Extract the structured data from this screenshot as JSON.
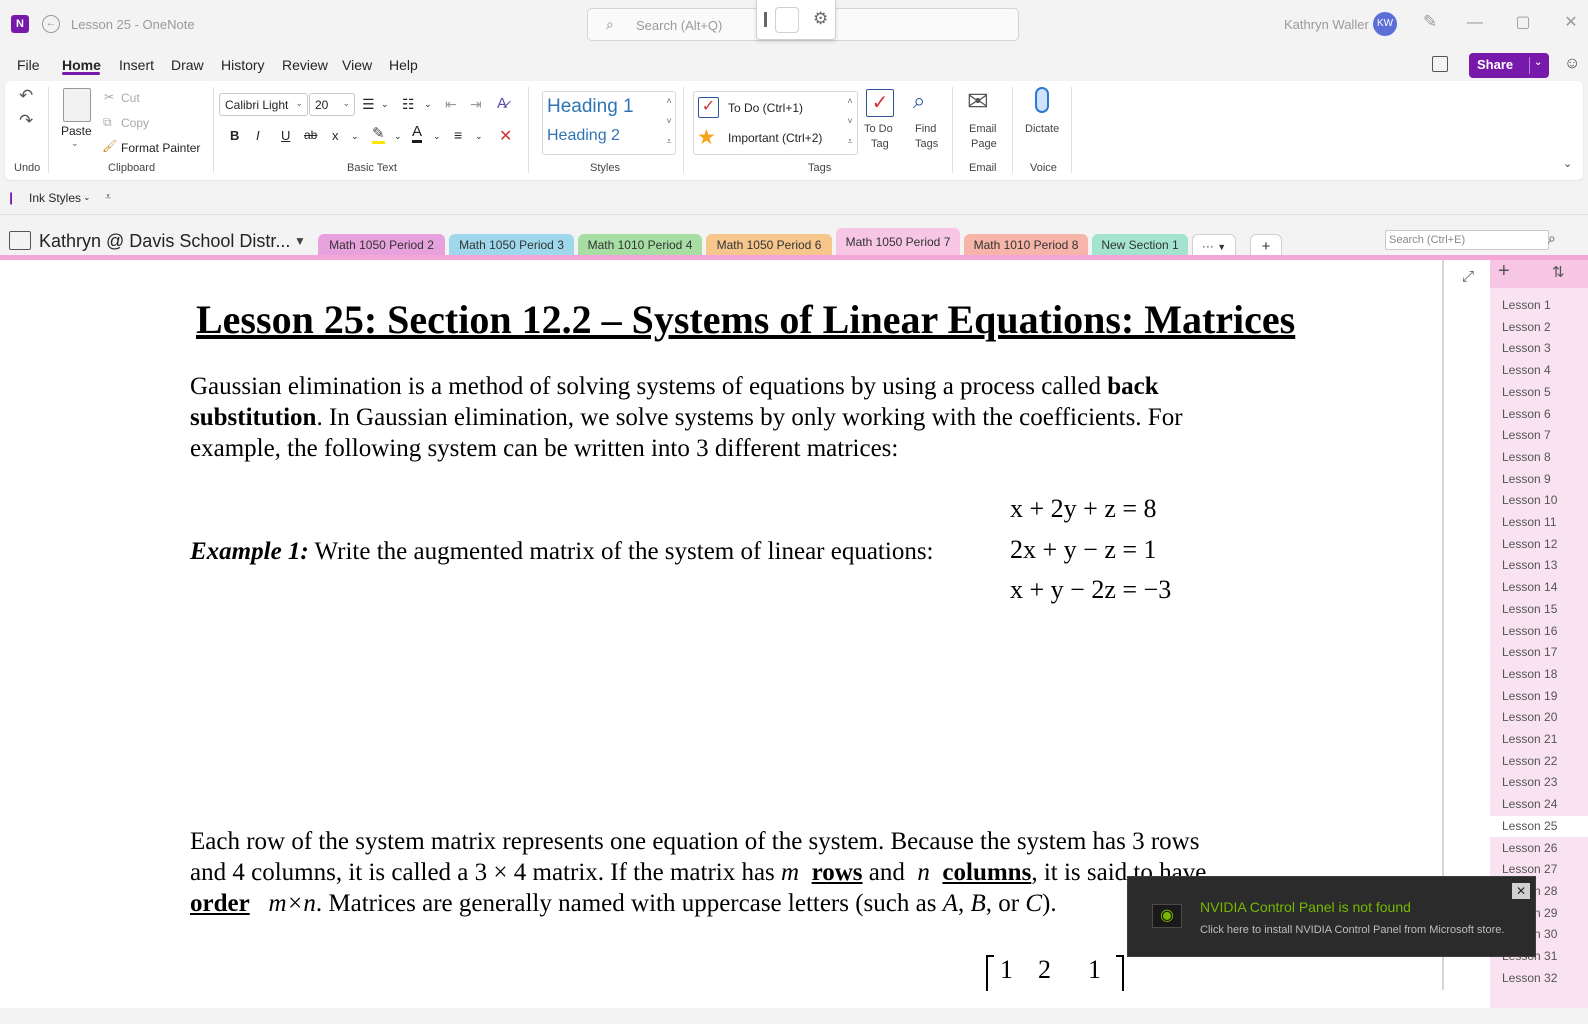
{
  "titlebar": {
    "doc_title": "Lesson 25  -  OneNote",
    "logo_text": "N",
    "search_placeholder": "Search (Alt+Q)",
    "user_name": "Kathryn Waller",
    "user_initials": "KW",
    "minimize": "—",
    "maximize": "▢",
    "close": "✕"
  },
  "menu": {
    "items": [
      "File",
      "Home",
      "Insert",
      "Draw",
      "History",
      "Review",
      "View",
      "Help"
    ],
    "active": "Home",
    "share_label": "Share"
  },
  "ribbon": {
    "undo_group": "Undo",
    "clipboard": {
      "paste": "Paste",
      "cut": "Cut",
      "copy": "Copy",
      "format_painter": "Format Painter",
      "label": "Clipboard"
    },
    "basic_text": {
      "font": "Calibri Light",
      "size": "20",
      "label": "Basic Text",
      "bold": "B",
      "italic": "I",
      "underline": "U",
      "strike": "ab",
      "subscript": "x",
      "font_color_letter": "A"
    },
    "styles": {
      "heading1": "Heading 1",
      "heading2": "Heading 2",
      "label": "Styles"
    },
    "tags": {
      "todo": "To Do (Ctrl+1)",
      "important": "Important (Ctrl+2)",
      "todo_tag_line1": "To Do",
      "todo_tag_line2": "Tag",
      "find_tags_line1": "Find",
      "find_tags_line2": "Tags",
      "label": "Tags"
    },
    "email": {
      "line1": "Email",
      "line2": "Page",
      "label": "Email"
    },
    "voice": {
      "dictate": "Dictate",
      "label": "Voice"
    }
  },
  "quick_access": {
    "ink_styles": "Ink Styles"
  },
  "notebook": {
    "name": "Kathryn @ Davis School Distr...",
    "sections": [
      {
        "label": "Math 1050 Period 2",
        "color": "#e7a1dc"
      },
      {
        "label": "Math 1050 Period 3",
        "color": "#9fd8ec"
      },
      {
        "label": "Math 1010 Period 4",
        "color": "#a6dea4"
      },
      {
        "label": "Math 1050 Period 6",
        "color": "#f6c68d"
      },
      {
        "label": "Math 1050 Period 7",
        "color": "#f6c6e4"
      },
      {
        "label": "Math 1010 Period 8",
        "color": "#f7b4a8"
      },
      {
        "label": "New Section 1",
        "color": "#a3e3cf"
      }
    ],
    "active_section": "Math 1050 Period 7",
    "more_sections": "···",
    "add_section": "+",
    "page_search_placeholder": "Search (Ctrl+E)"
  },
  "page": {
    "title": "Lesson 25: Section 12.2 – Systems of Linear Equations:  Matrices",
    "p1": {
      "line1_a": "Gaussian elimination is a method of solving systems of equations by using a process called ",
      "line1_b": "back",
      "line2_a": "substitution",
      "line2_b": ".  In Gaussian elimination, we solve systems by only working with the coefficients.  For",
      "line3": "example, the following system can be written into 3 different matrices:"
    },
    "example": {
      "label": "Example 1:",
      "text": "  Write the augmented matrix of the system of linear equations:"
    },
    "equations": [
      "x + 2y + z = 8",
      "2x + y − z = 1",
      "x + y − 2z = −3"
    ],
    "p2": {
      "line1": "Each row of the system matrix represents one equation of the system.  Because the system has 3 rows",
      "line2_a": "and 4 columns, it is called a 3 × 4 matrix.   If the matrix has ",
      "line2_m": "m",
      "line2_rows": "rows",
      "line2_and": " and ",
      "line2_n": "n",
      "line2_cols": "columns",
      "line2_end": ", it is said to have",
      "line3_order": "order",
      "line3_mn": "m×n",
      "line3_rest_a": ".  Matrices are generally named with uppercase letters (such as ",
      "line3_A": "A",
      "line3_B": "B",
      "line3_or": ", or ",
      "line3_C": "C",
      "line3_end": ")."
    },
    "matrix_row1": [
      "1",
      "2",
      "1"
    ]
  },
  "pages": [
    "Lesson 1",
    "Lesson 2",
    "Lesson 3",
    "Lesson 4",
    "Lesson 5",
    "Lesson 6",
    "Lesson 7",
    "Lesson 8",
    "Lesson 9",
    "Lesson 10",
    "Lesson 11",
    "Lesson 12",
    "Lesson 13",
    "Lesson 14",
    "Lesson 15",
    "Lesson 16",
    "Lesson 17",
    "Lesson 18",
    "Lesson 19",
    "Lesson 20",
    "Lesson 21",
    "Lesson 22",
    "Lesson 23",
    "Lesson 24",
    "Lesson 25",
    "Lesson 26",
    "Lesson 27",
    "Lesson 28",
    "Lesson 29",
    "Lesson 30",
    "Lesson 31",
    "Lesson 32"
  ],
  "active_page": "Lesson 25",
  "toast": {
    "title": "NVIDIA Control Panel is not found",
    "subtitle": "Click here to install NVIDIA Control Panel from Microsoft store."
  },
  "colors": {
    "accent": "#7719aa",
    "heading_blue": "#2e74b5",
    "nvidia_green": "#76b900",
    "page_list_bg": "#f9e3f1"
  }
}
